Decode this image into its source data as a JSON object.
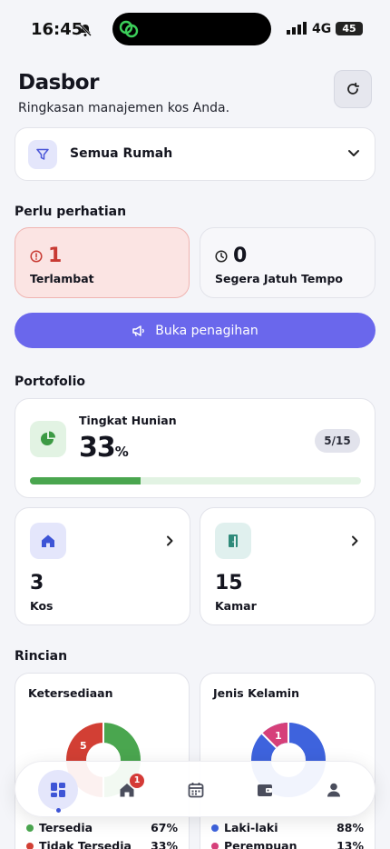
{
  "status": {
    "time": "16:45",
    "network": "4G",
    "battery": "45"
  },
  "header": {
    "title": "Dasbor",
    "subtitle": "Ringkasan manajemen kos Anda."
  },
  "filter": {
    "label": "Semua Rumah"
  },
  "attention": {
    "heading": "Perlu perhatian",
    "late": {
      "count": "1",
      "label": "Terlambat"
    },
    "due_soon": {
      "count": "0",
      "label": "Segera Jatuh Tempo"
    }
  },
  "billing_button": "Buka penagihan",
  "portfolio": {
    "heading": "Portofolio",
    "occupancy": {
      "label": "Tingkat Hunian",
      "value": "33",
      "unit": "%",
      "ratio": "5/15",
      "fraction": 0.333
    },
    "kos": {
      "count": "3",
      "label": "Kos"
    },
    "kamar": {
      "count": "15",
      "label": "Kamar"
    }
  },
  "details": {
    "heading": "Rincian",
    "availability": {
      "title": "Ketersediaan",
      "slice_label": "5",
      "items": [
        {
          "label": "Tersedia",
          "pct": "67%",
          "color": "#4aa64f"
        },
        {
          "label": "Tidak Tersedia",
          "pct": "33%",
          "color": "#d23f34"
        }
      ]
    },
    "gender": {
      "title": "Jenis Kelamin",
      "slice_label": "1",
      "items": [
        {
          "label": "Laki-laki",
          "pct": "88%",
          "color": "#3e63dd"
        },
        {
          "label": "Perempuan",
          "pct": "13%",
          "color": "#d6407a"
        }
      ]
    }
  },
  "nav": {
    "home_badge": "1"
  },
  "colors": {
    "accent": "#6a67ec",
    "green": "#4aa64f",
    "red": "#d23f34",
    "blue": "#3e63dd",
    "pink": "#d6407a"
  },
  "icons": [
    "bell-off-icon",
    "refresh-icon",
    "filter-icon",
    "chevron-down-icon",
    "alert-circle-icon",
    "clock-icon",
    "megaphone-icon",
    "pie-chart-icon",
    "home-icon",
    "door-icon",
    "chevron-right-icon",
    "dashboard-icon",
    "calendar-icon",
    "wallet-icon",
    "user-icon"
  ]
}
